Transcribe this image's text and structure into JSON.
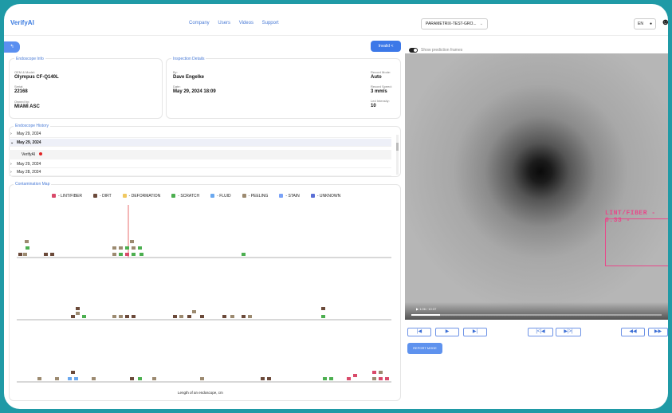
{
  "header": {
    "logo": "VerifyAI",
    "nav": [
      "Company",
      "Users",
      "Videos",
      "Support"
    ],
    "device": "PARAMETRIX-TEST-GRO...",
    "lang": "EN"
  },
  "toolbar": {
    "back_label": "↰",
    "share_label": "Invalid"
  },
  "endoscope_info": {
    "title": "Endoscope Info",
    "oem_label": "OEM & Model:",
    "oem": "Olympus CF-Q140L",
    "serial_label": "Serial:",
    "serial": "22168",
    "owned_label": "Owned by:",
    "owned": "MIAMI ASC"
  },
  "inspection": {
    "title": "Inspection Details",
    "by_label": "By:",
    "by": "Dave Engelke",
    "date_label": "Date:",
    "date": "May 29, 2024 18:09",
    "mode_label": "Record Mode:",
    "mode": "Auto",
    "speed_label": "Record Speed:",
    "speed": "3 mm/s",
    "led_label": "Led Intensity:",
    "led": "10"
  },
  "history": {
    "title": "Endoscope History",
    "rows": [
      "May 29, 2024",
      "May 29, 2024",
      "May 29, 2024",
      "May 28, 2024"
    ],
    "verifyai": "VerifyAI"
  },
  "contamination": {
    "title": "Contamination Map",
    "legend": [
      {
        "label": "- LINT/FIBER",
        "color": "#d94a6a"
      },
      {
        "label": "- DIRT",
        "color": "#6b4a3a"
      },
      {
        "label": "- DEFORMATION",
        "color": "#f0c860"
      },
      {
        "label": "- SCRATCH",
        "color": "#4caf50"
      },
      {
        "label": "- FLUID",
        "color": "#6aa8ef"
      },
      {
        "label": "- PEELING",
        "color": "#9c8a70"
      },
      {
        "label": "- STAIN",
        "color": "#7aa2f7"
      },
      {
        "label": "- UNKNOWN",
        "color": "#5b6fd6"
      }
    ],
    "axis_label": "Length of an endoscope, cm"
  },
  "video": {
    "toggle_label": "Show prediction frames",
    "detection_label": "LINT/FIBER - 0.33 -",
    "time": "▶  1:06 / 10:37"
  },
  "controls": {
    "first": "|◀",
    "play": "▶",
    "last": "▶|",
    "frame_back": "|<|◀",
    "frame_fwd": "▶|>|",
    "rew": "◀◀",
    "ff": "▶▶"
  },
  "report_label": "REPORT MODE"
}
